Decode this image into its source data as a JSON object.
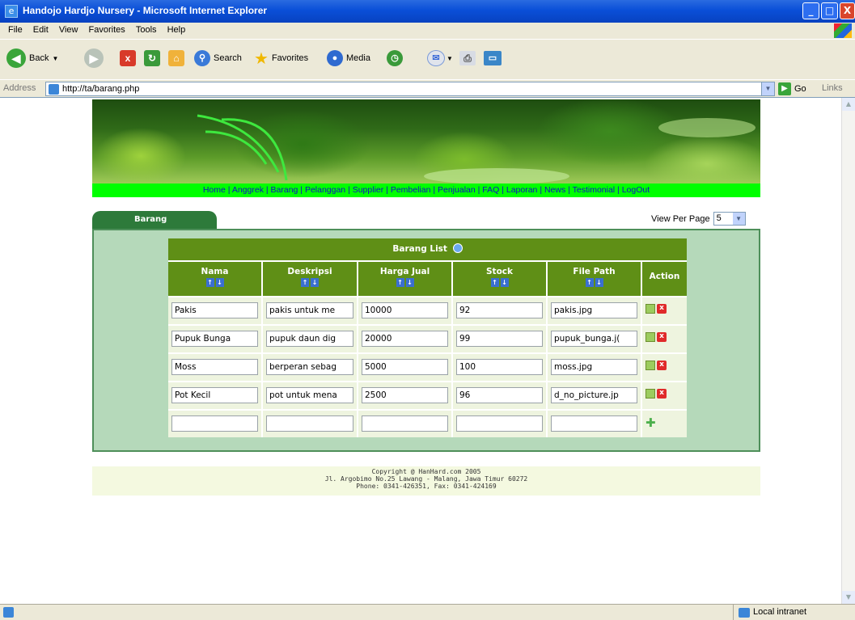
{
  "window": {
    "title": "Handojo Hardjo Nursery - Microsoft Internet Explorer"
  },
  "menu": [
    "File",
    "Edit",
    "View",
    "Favorites",
    "Tools",
    "Help"
  ],
  "toolbar": {
    "back": "Back",
    "search": "Search",
    "favorites": "Favorites",
    "media": "Media"
  },
  "address": {
    "label": "Address",
    "url": "http://ta/barang.php",
    "go": "Go",
    "links": "Links"
  },
  "nav": [
    "Home",
    "Anggrek",
    "Barang",
    "Pelanggan",
    "Supplier",
    "Pembelian",
    "Penjualan",
    "FAQ",
    "Laporan",
    "News",
    "Testimonial",
    "LogOut"
  ],
  "tab": {
    "label": "Barang"
  },
  "view_per_page": {
    "label": "View Per Page",
    "value": "5"
  },
  "list": {
    "title": "Barang List",
    "columns": [
      "Nama",
      "Deskripsi",
      "Harga Jual",
      "Stock",
      "File Path",
      "Action"
    ],
    "rows": [
      {
        "nama": "Pakis",
        "deskripsi": "pakis untuk me",
        "harga": "10000",
        "stock": "92",
        "file": "pakis.jpg"
      },
      {
        "nama": "Pupuk Bunga",
        "deskripsi": "pupuk daun dig",
        "harga": "20000",
        "stock": "99",
        "file": "pupuk_bunga.j("
      },
      {
        "nama": "Moss",
        "deskripsi": "berperan sebag",
        "harga": "5000",
        "stock": "100",
        "file": "moss.jpg"
      },
      {
        "nama": "Pot Kecil",
        "deskripsi": "pot untuk mena",
        "harga": "2500",
        "stock": "96",
        "file": "d_no_picture.jp"
      }
    ]
  },
  "footer": {
    "line1": "Copyright @ HanHard.com  2005",
    "line2": "Jl. Argobimo No.25 Lawang - Malang, Jawa Timur 60272",
    "line3": "Phone: 0341-426351, Fax: 0341-424169"
  },
  "status": {
    "zone": "Local intranet"
  }
}
